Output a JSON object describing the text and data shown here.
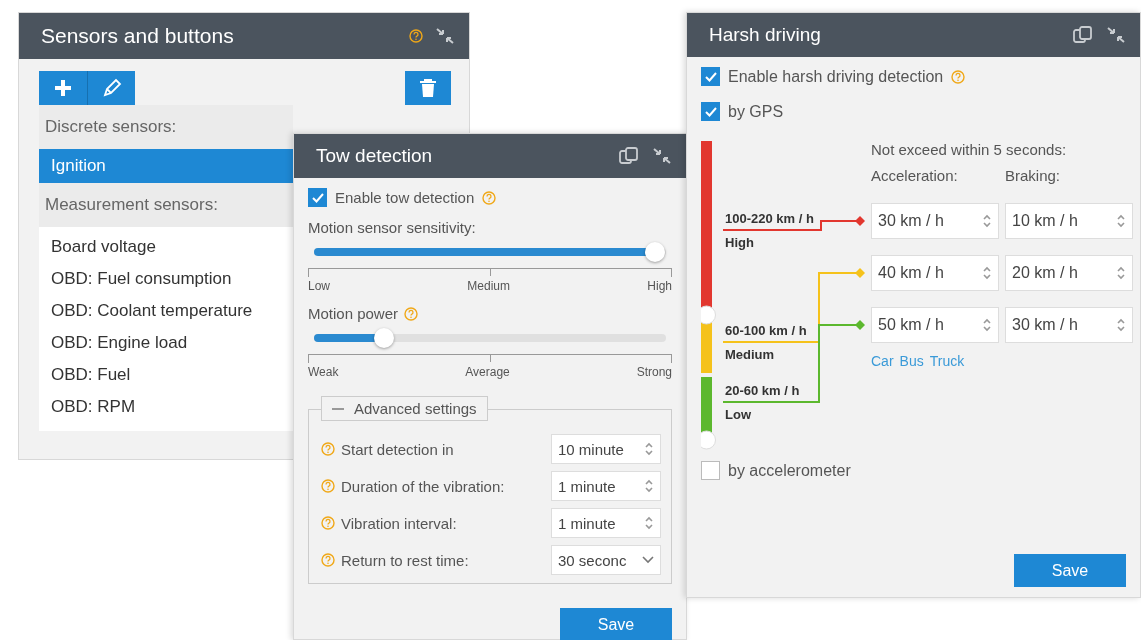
{
  "sensors_window": {
    "title": "Sensors and buttons",
    "groups": [
      {
        "heading": "Discrete sensors:",
        "items": [
          {
            "label": "Ignition",
            "selected": true
          }
        ]
      },
      {
        "heading": "Measurement sensors:",
        "items": [
          {
            "label": "Board voltage",
            "selected": false
          },
          {
            "label": "OBD: Fuel consumption",
            "selected": false
          },
          {
            "label": "OBD: Coolant temperature",
            "selected": false
          },
          {
            "label": "OBD: Engine load",
            "selected": false
          },
          {
            "label": "OBD: Fuel",
            "selected": false
          },
          {
            "label": "OBD: RPM",
            "selected": false
          }
        ]
      }
    ]
  },
  "tow_window": {
    "title": "Tow detection",
    "enable": {
      "label": "Enable tow detection",
      "checked": true
    },
    "sliders": [
      {
        "label": "Motion sensor sensitivity:",
        "help": false,
        "level": 0.97,
        "ticks": [
          "Low",
          "Medium",
          "High"
        ]
      },
      {
        "label": "Motion power",
        "help": true,
        "level": 0.2,
        "ticks": [
          "Weak",
          "Average",
          "Strong"
        ]
      }
    ],
    "advanced": {
      "label": "Advanced settings",
      "expanded": true,
      "fields": [
        {
          "label": "Start detection in",
          "value": "10 minute",
          "kind": "spinner"
        },
        {
          "label": "Duration of the vibration:",
          "value": "1 minute",
          "kind": "spinner"
        },
        {
          "label": "Vibration interval:",
          "value": "1 minute",
          "kind": "spinner"
        },
        {
          "label": "Return to rest time:",
          "value": "30 seconc",
          "kind": "select"
        }
      ]
    },
    "save": "Save"
  },
  "harsh_window": {
    "title": "Harsh driving",
    "enable": {
      "label": "Enable harsh driving detection",
      "checked": true
    },
    "by_gps": {
      "label": "by GPS",
      "checked": true
    },
    "header": "Not exceed within 5 seconds:",
    "columns": [
      "Acceleration:",
      "Braking:"
    ],
    "zones": [
      {
        "range": "100-220 km / h",
        "name": "High",
        "color": "#e2372f",
        "acceleration": "30 km / h",
        "braking": "10 km / h"
      },
      {
        "range": "60-100 km / h",
        "name": "Medium",
        "color": "#f5c21b",
        "acceleration": "40 km / h",
        "braking": "20 km / h"
      },
      {
        "range": "20-60 km / h",
        "name": "Low",
        "color": "#5cb82e",
        "acceleration": "50 km / h",
        "braking": "30 km / h"
      }
    ],
    "vehicle_links": [
      "Car",
      "Bus",
      "Truck"
    ],
    "accelerometer": {
      "label": "by accelerometer",
      "checked": false
    },
    "save": "Save"
  }
}
